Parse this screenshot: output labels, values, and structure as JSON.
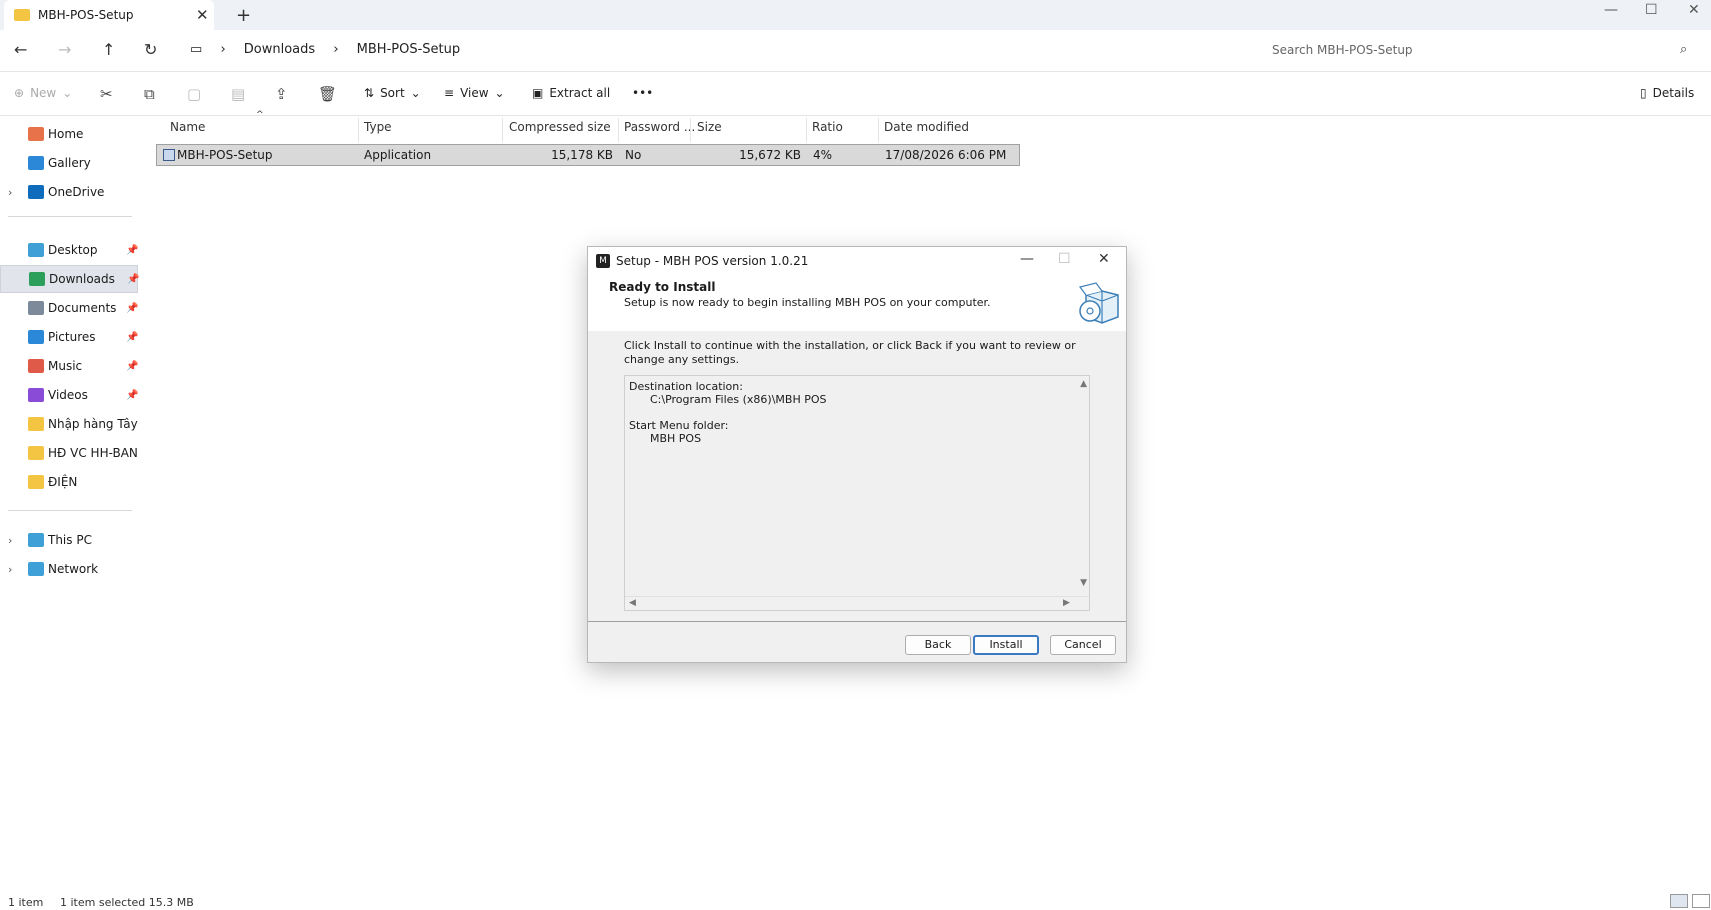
{
  "window": {
    "tab_title": "MBH-POS-Setup",
    "tab_close": "✕",
    "new_tab": "+",
    "minimize": "—",
    "maximize": "☐",
    "close": "✕"
  },
  "nav": {
    "back_icon": "←",
    "forward_icon": "→",
    "up_icon": "↑",
    "refresh_icon": "↻",
    "computer_icon": "▭",
    "breadcrumb": [
      "Downloads",
      "MBH-POS-Setup"
    ],
    "separator": "›"
  },
  "search": {
    "placeholder": "Search MBH-POS-Setup",
    "icon": "⌕"
  },
  "toolbar": {
    "new_label": "New",
    "sort_label": "Sort",
    "view_label": "View",
    "extract_label": "Extract all",
    "more_label": "•••",
    "details_label": "Details",
    "cut_icon": "✂",
    "copy_icon": "⧉",
    "paste_icon": "▢",
    "rename_icon": "▤",
    "share_icon": "⇪",
    "delete_icon": "🗑"
  },
  "sidebar": {
    "quick": [
      {
        "label": "Home",
        "color": "#e8734a"
      },
      {
        "label": "Gallery",
        "color": "#2b88d8"
      },
      {
        "label": "OneDrive",
        "color": "#0f6cbd"
      }
    ],
    "pinned": [
      {
        "label": "Desktop",
        "color": "#3ea0d6"
      },
      {
        "label": "Downloads",
        "color": "#2ca05a"
      },
      {
        "label": "Documents",
        "color": "#7d8a99"
      },
      {
        "label": "Pictures",
        "color": "#2b88d8"
      },
      {
        "label": "Music",
        "color": "#e05a4a"
      },
      {
        "label": "Videos",
        "color": "#8a4bd6"
      },
      {
        "label": "Nhập hàng Tây Nam",
        "color": "#f4c542"
      },
      {
        "label": "HĐ VC HH-BAN CH",
        "color": "#f4c542"
      },
      {
        "label": "ĐIỆN",
        "color": "#f4c542"
      }
    ],
    "system": [
      {
        "label": "This PC",
        "color": "#3ea0d6"
      },
      {
        "label": "Network",
        "color": "#3ea0d6"
      }
    ]
  },
  "columns": [
    "Name",
    "Type",
    "Compressed size",
    "Password ...",
    "Size",
    "Ratio",
    "Date modified"
  ],
  "files": [
    {
      "name": "MBH-POS-Setup",
      "type": "Application",
      "compressed_size": "15,178 KB",
      "password": "No",
      "size": "15,672 KB",
      "ratio": "4%",
      "date_modified": "17/08/2026 6:06 PM"
    }
  ],
  "dialog": {
    "title": "Setup - MBH POS version 1.0.21",
    "heading": "Ready to Install",
    "subheading": "Setup is now ready to begin installing MBH POS on your computer.",
    "description": "Click Install to continue with the installation, or click Back if you want to review or change any settings.",
    "memo": "Destination location:\n      C:\\Program Files (x86)\\MBH POS\n\nStart Menu folder:\n      MBH POS",
    "back_label": "Back",
    "install_label": "Install",
    "cancel_label": "Cancel"
  },
  "status": {
    "items": "1 item",
    "selected": "1 item selected  15.3 MB"
  }
}
